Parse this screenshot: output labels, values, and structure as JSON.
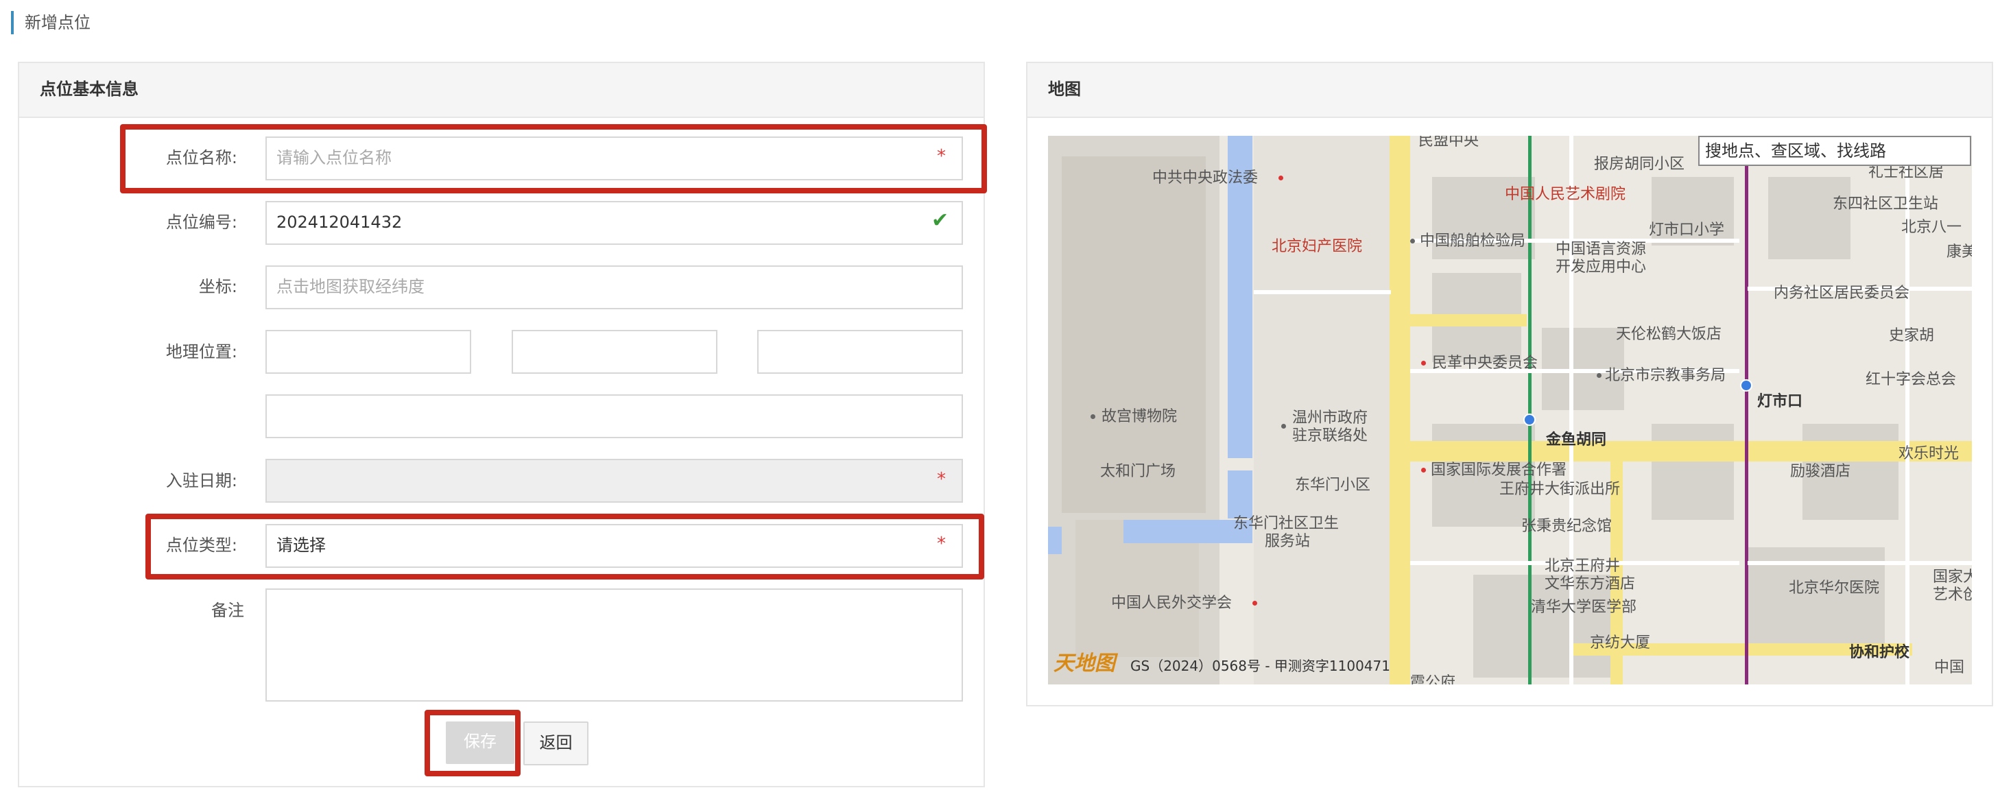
{
  "page": {
    "title": "新增点位"
  },
  "form_panel": {
    "title": "点位基本信息",
    "fields": {
      "name": {
        "label": "点位名称:",
        "placeholder": "请输入点位名称",
        "required": "*"
      },
      "code": {
        "label": "点位编号:",
        "value": "202412041432"
      },
      "coords": {
        "label": "坐标:",
        "placeholder": "点击地图获取经纬度"
      },
      "geo": {
        "label": "地理位置:"
      },
      "date": {
        "label": "入驻日期:",
        "required": "*"
      },
      "type": {
        "label": "点位类型:",
        "value": "请选择",
        "required": "*"
      },
      "remark": {
        "label": "备注"
      }
    },
    "buttons": {
      "save": "保存",
      "back": "返回"
    }
  },
  "map_panel": {
    "title": "地图",
    "search_placeholder": "搜地点、查区域、找线路",
    "copyright": "GS（2024）0568号 - 甲测资字1100471",
    "logo": "天地图",
    "labels": [
      "民盟中央",
      "中共中央政法委",
      "报房胡同小区",
      "礼士社区居",
      "中国人民艺术剧院",
      "东四社区卫生站",
      "北京妇产医院",
      "中国船舶检验局",
      "中国语言资源",
      "开发应用中心",
      "灯市口小学",
      "北京八一",
      "康美",
      "内务社区居民委员会",
      "天伦松鹤大饭店",
      "史家胡",
      "民革中央委员会",
      "北京市宗教事务局",
      "红十字会总会",
      "故宫博物院",
      "温州市政府",
      "驻京联络处",
      "灯市口",
      "金鱼胡同",
      "欢乐时光",
      "太和门广场",
      "东华门小区",
      "国家国际发展合作署",
      "王府井大街派出所",
      "励骏酒店",
      "东华门社区卫生",
      "服务站",
      "张秉贵纪念馆",
      "北京王府井",
      "文华东方酒店",
      "北京华尔医院",
      "国家大",
      "艺术创",
      "中国人民外交学会",
      "清华大学医学部",
      "京纺大厦",
      "协和护校",
      "中国",
      "霞公府"
    ]
  },
  "colors": {
    "accent": "#3c8dbc",
    "highlight": "#c8281c",
    "required": "#e23b3b"
  }
}
